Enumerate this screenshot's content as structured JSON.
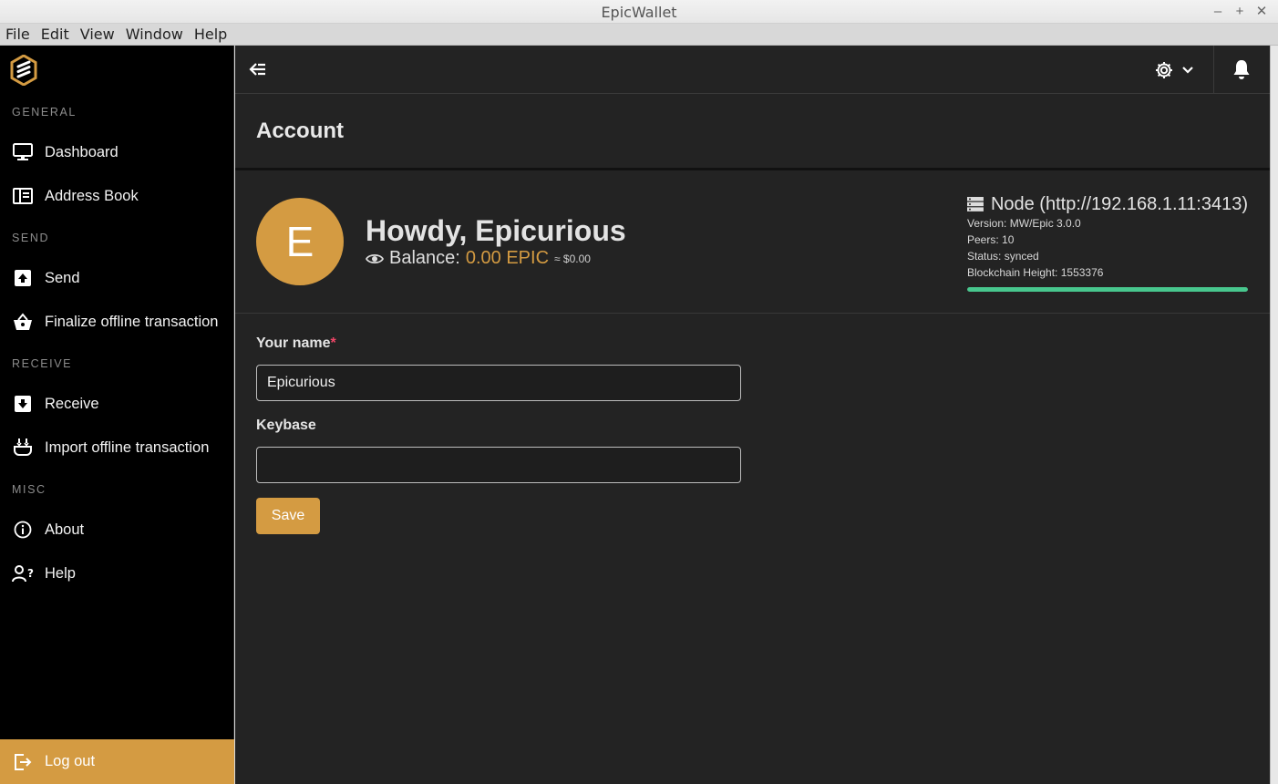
{
  "window": {
    "title": "EpicWallet"
  },
  "menu": [
    "File",
    "Edit",
    "View",
    "Window",
    "Help"
  ],
  "sidebar": {
    "sections": {
      "general": "GENERAL",
      "send": "SEND",
      "receive": "RECEIVE",
      "misc": "MISC"
    },
    "items": {
      "dashboard": {
        "label": "Dashboard",
        "icon": "monitor-icon"
      },
      "address_book": {
        "label": "Address Book",
        "icon": "address-book-icon"
      },
      "send": {
        "label": "Send",
        "icon": "send-box-icon"
      },
      "finalize": {
        "label": "Finalize offline transaction",
        "icon": "basket-icon"
      },
      "receive": {
        "label": "Receive",
        "icon": "receive-box-icon"
      },
      "import": {
        "label": "Import offline transaction",
        "icon": "import-icon"
      },
      "about": {
        "label": "About",
        "icon": "info-icon"
      },
      "help": {
        "label": "Help",
        "icon": "user-question-icon"
      }
    },
    "logout": {
      "label": "Log out",
      "icon": "logout-icon"
    }
  },
  "page": {
    "title": "Account"
  },
  "account": {
    "avatar_letter": "E",
    "greeting": "Howdy, Epicurious",
    "balance_label": "Balance:",
    "balance_amount": "0.00 EPIC",
    "balance_usd": "≈ $0.00"
  },
  "node": {
    "title": "Node (http://192.168.1.11:3413)",
    "version": "Version: MW/Epic 3.0.0",
    "peers": "Peers: 10",
    "status": "Status: synced",
    "height": "Blockchain Height: 1553376",
    "sync_progress": 1.0
  },
  "form": {
    "name_label": "Your name",
    "name_required_mark": "*",
    "name_value": "Epicurious",
    "keybase_label": "Keybase",
    "keybase_value": "",
    "save_label": "Save"
  },
  "colors": {
    "accent": "#d49b42",
    "sidebar_bg": "#000000",
    "main_bg": "#232323",
    "progress": "#48c78e",
    "required": "#f14668"
  }
}
